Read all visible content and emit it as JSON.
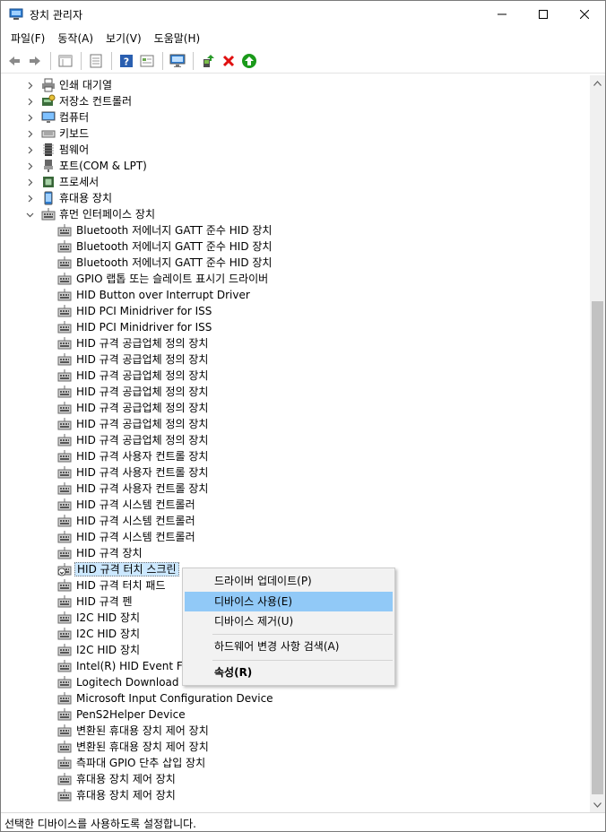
{
  "window": {
    "title": "장치 관리자",
    "min_glyph": "—",
    "max_glyph": "☐",
    "close_glyph": "✕"
  },
  "menu": [
    "파일(F)",
    "동작(A)",
    "보기(V)",
    "도움말(H)"
  ],
  "toolbar": {
    "buttons": [
      "back-icon",
      "forward-icon",
      "tree-view-icon",
      "properties-icon",
      "help-icon",
      "view-icon",
      "monitor-icon",
      "update-driver-icon",
      "uninstall-icon",
      "enable-device-icon"
    ],
    "enable_color": "#1a9a1a",
    "uninstall_color": "#e01010"
  },
  "tree": {
    "categories": [
      {
        "label": "인쇄 대기열",
        "icon": "printer-icon"
      },
      {
        "label": "저장소 컨트롤러",
        "icon": "storage-controller-icon"
      },
      {
        "label": "컴퓨터",
        "icon": "computer-icon"
      },
      {
        "label": "키보드",
        "icon": "keyboard-icon"
      },
      {
        "label": "펌웨어",
        "icon": "firmware-icon"
      },
      {
        "label": "포트(COM & LPT)",
        "icon": "port-icon"
      },
      {
        "label": "프로세서",
        "icon": "processor-icon"
      },
      {
        "label": "휴대용 장치",
        "icon": "portable-device-icon"
      }
    ],
    "expanded": {
      "label": "휴먼 인터페이스 장치",
      "icon": "hid-icon"
    },
    "children": [
      "Bluetooth 저에너지 GATT 준수 HID 장치",
      "Bluetooth 저에너지 GATT 준수 HID 장치",
      "Bluetooth 저에너지 GATT 준수 HID 장치",
      "GPIO 랩톱 또는 슬레이트 표시기 드라이버",
      "HID Button over Interrupt Driver",
      "HID PCI Minidriver for ISS",
      "HID PCI Minidriver for ISS",
      "HID 규격 공급업체 정의 장치",
      "HID 규격 공급업체 정의 장치",
      "HID 규격 공급업체 정의 장치",
      "HID 규격 공급업체 정의 장치",
      "HID 규격 공급업체 정의 장치",
      "HID 규격 공급업체 정의 장치",
      "HID 규격 공급업체 정의 장치",
      "HID 규격 사용자 컨트롤 장치",
      "HID 규격 사용자 컨트롤 장치",
      "HID 규격 사용자 컨트롤 장치",
      "HID 규격 시스템 컨트롤러",
      "HID 규격 시스템 컨트롤러",
      "HID 규격 시스템 컨트롤러",
      "HID 규격 장치",
      "HID 규격 터치 스크린",
      "HID 규격 터치 패드",
      "HID 규격 펜",
      "I2C HID 장치",
      "I2C HID 장치",
      "I2C HID 장치",
      "Intel(R) HID Event Filte",
      "Logitech Download A",
      "Microsoft Input Configuration Device",
      "PenS2Helper Device",
      "변환된 휴대용 장치 제어 장치",
      "변환된 휴대용 장치 제어 장치",
      "측파대 GPIO 단추 삽입 장치",
      "휴대용 장치 제어 장치",
      "휴대용 장치 제어 장치"
    ],
    "selected_index": 21,
    "disabled_index": 21
  },
  "context_menu": {
    "items": [
      {
        "label": "드라이버 업데이트(P)"
      },
      {
        "label": "디바이스 사용(E)",
        "highlighted": true
      },
      {
        "label": "디바이스 제거(U)"
      },
      {
        "label": "하드웨어 변경 사항 검색(A)"
      },
      {
        "label": "속성(R)",
        "bold": true
      }
    ]
  },
  "status_bar": "선택한 디바이스를 사용하도록 설정합니다."
}
